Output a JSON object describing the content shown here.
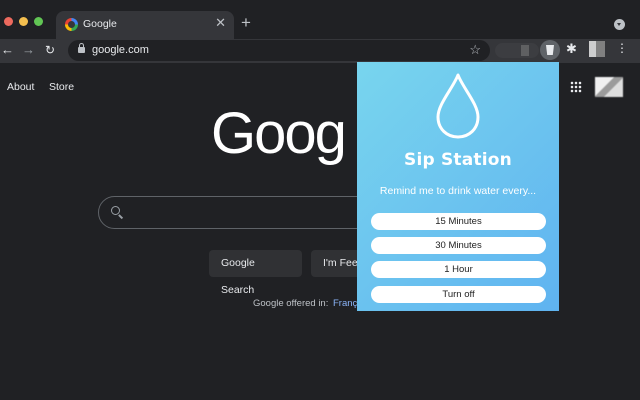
{
  "browser": {
    "tab": {
      "title": "Google",
      "close": "✕"
    },
    "new_tab": "+",
    "nav": {
      "back": "←",
      "forward": "→",
      "reload": "↻"
    },
    "url": "google.com",
    "star": "☆",
    "puzzle": "✱",
    "menu": "⋮"
  },
  "google": {
    "links": {
      "about": "About",
      "store": "Store"
    },
    "logo_text": "Goog",
    "buttons": {
      "search": "Google Search",
      "lucky": "I'm Feeling Lucky"
    },
    "offered_in": "Google offered in:",
    "language": "Français"
  },
  "popup": {
    "title": "Sip Station",
    "subtitle": "Remind me to drink water every...",
    "options": [
      "15 Minutes",
      "30 Minutes",
      "1 Hour",
      "Turn off"
    ],
    "background_color": "#6cc4ef"
  }
}
